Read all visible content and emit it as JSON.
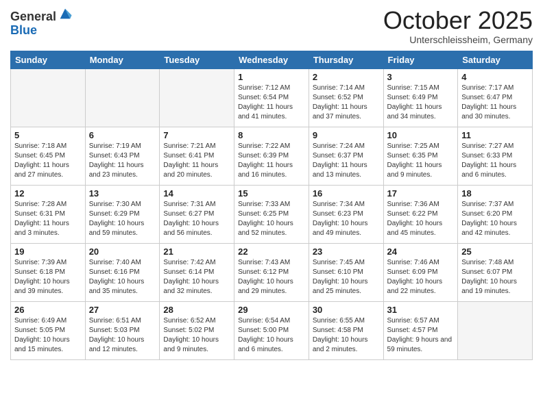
{
  "logo": {
    "general": "General",
    "blue": "Blue"
  },
  "title": "October 2025",
  "subtitle": "Unterschleissheim, Germany",
  "headers": [
    "Sunday",
    "Monday",
    "Tuesday",
    "Wednesday",
    "Thursday",
    "Friday",
    "Saturday"
  ],
  "weeks": [
    [
      {
        "day": "",
        "info": ""
      },
      {
        "day": "",
        "info": ""
      },
      {
        "day": "",
        "info": ""
      },
      {
        "day": "1",
        "info": "Sunrise: 7:12 AM\nSunset: 6:54 PM\nDaylight: 11 hours and 41 minutes."
      },
      {
        "day": "2",
        "info": "Sunrise: 7:14 AM\nSunset: 6:52 PM\nDaylight: 11 hours and 37 minutes."
      },
      {
        "day": "3",
        "info": "Sunrise: 7:15 AM\nSunset: 6:49 PM\nDaylight: 11 hours and 34 minutes."
      },
      {
        "day": "4",
        "info": "Sunrise: 7:17 AM\nSunset: 6:47 PM\nDaylight: 11 hours and 30 minutes."
      }
    ],
    [
      {
        "day": "5",
        "info": "Sunrise: 7:18 AM\nSunset: 6:45 PM\nDaylight: 11 hours and 27 minutes."
      },
      {
        "day": "6",
        "info": "Sunrise: 7:19 AM\nSunset: 6:43 PM\nDaylight: 11 hours and 23 minutes."
      },
      {
        "day": "7",
        "info": "Sunrise: 7:21 AM\nSunset: 6:41 PM\nDaylight: 11 hours and 20 minutes."
      },
      {
        "day": "8",
        "info": "Sunrise: 7:22 AM\nSunset: 6:39 PM\nDaylight: 11 hours and 16 minutes."
      },
      {
        "day": "9",
        "info": "Sunrise: 7:24 AM\nSunset: 6:37 PM\nDaylight: 11 hours and 13 minutes."
      },
      {
        "day": "10",
        "info": "Sunrise: 7:25 AM\nSunset: 6:35 PM\nDaylight: 11 hours and 9 minutes."
      },
      {
        "day": "11",
        "info": "Sunrise: 7:27 AM\nSunset: 6:33 PM\nDaylight: 11 hours and 6 minutes."
      }
    ],
    [
      {
        "day": "12",
        "info": "Sunrise: 7:28 AM\nSunset: 6:31 PM\nDaylight: 11 hours and 3 minutes."
      },
      {
        "day": "13",
        "info": "Sunrise: 7:30 AM\nSunset: 6:29 PM\nDaylight: 10 hours and 59 minutes."
      },
      {
        "day": "14",
        "info": "Sunrise: 7:31 AM\nSunset: 6:27 PM\nDaylight: 10 hours and 56 minutes."
      },
      {
        "day": "15",
        "info": "Sunrise: 7:33 AM\nSunset: 6:25 PM\nDaylight: 10 hours and 52 minutes."
      },
      {
        "day": "16",
        "info": "Sunrise: 7:34 AM\nSunset: 6:23 PM\nDaylight: 10 hours and 49 minutes."
      },
      {
        "day": "17",
        "info": "Sunrise: 7:36 AM\nSunset: 6:22 PM\nDaylight: 10 hours and 45 minutes."
      },
      {
        "day": "18",
        "info": "Sunrise: 7:37 AM\nSunset: 6:20 PM\nDaylight: 10 hours and 42 minutes."
      }
    ],
    [
      {
        "day": "19",
        "info": "Sunrise: 7:39 AM\nSunset: 6:18 PM\nDaylight: 10 hours and 39 minutes."
      },
      {
        "day": "20",
        "info": "Sunrise: 7:40 AM\nSunset: 6:16 PM\nDaylight: 10 hours and 35 minutes."
      },
      {
        "day": "21",
        "info": "Sunrise: 7:42 AM\nSunset: 6:14 PM\nDaylight: 10 hours and 32 minutes."
      },
      {
        "day": "22",
        "info": "Sunrise: 7:43 AM\nSunset: 6:12 PM\nDaylight: 10 hours and 29 minutes."
      },
      {
        "day": "23",
        "info": "Sunrise: 7:45 AM\nSunset: 6:10 PM\nDaylight: 10 hours and 25 minutes."
      },
      {
        "day": "24",
        "info": "Sunrise: 7:46 AM\nSunset: 6:09 PM\nDaylight: 10 hours and 22 minutes."
      },
      {
        "day": "25",
        "info": "Sunrise: 7:48 AM\nSunset: 6:07 PM\nDaylight: 10 hours and 19 minutes."
      }
    ],
    [
      {
        "day": "26",
        "info": "Sunrise: 6:49 AM\nSunset: 5:05 PM\nDaylight: 10 hours and 15 minutes."
      },
      {
        "day": "27",
        "info": "Sunrise: 6:51 AM\nSunset: 5:03 PM\nDaylight: 10 hours and 12 minutes."
      },
      {
        "day": "28",
        "info": "Sunrise: 6:52 AM\nSunset: 5:02 PM\nDaylight: 10 hours and 9 minutes."
      },
      {
        "day": "29",
        "info": "Sunrise: 6:54 AM\nSunset: 5:00 PM\nDaylight: 10 hours and 6 minutes."
      },
      {
        "day": "30",
        "info": "Sunrise: 6:55 AM\nSunset: 4:58 PM\nDaylight: 10 hours and 2 minutes."
      },
      {
        "day": "31",
        "info": "Sunrise: 6:57 AM\nSunset: 4:57 PM\nDaylight: 9 hours and 59 minutes."
      },
      {
        "day": "",
        "info": ""
      }
    ]
  ]
}
